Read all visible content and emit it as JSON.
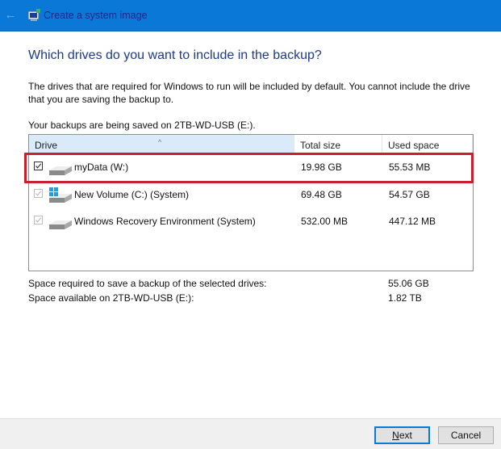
{
  "window": {
    "title": "Create a system image",
    "back_icon": "back-arrow-icon",
    "app_icon": "system-image-icon",
    "titlebar_color": "#0a78d7"
  },
  "page": {
    "heading": "Which drives do you want to include in the backup?",
    "description": "The drives that are required for Windows to run will be included by default. You cannot include the drive that you are saving the backup to.",
    "saved_on": "Your backups are being saved on 2TB-WD-USB (E:)."
  },
  "drive_list": {
    "columns": {
      "drive": "Drive",
      "total": "Total size",
      "used": "Used space"
    },
    "sort_indicator": "^",
    "rows": [
      {
        "name": "myData (W:)",
        "total": "19.98 GB",
        "used": "55.53 MB",
        "checked": true,
        "enabled": true,
        "icon": "drive-icon"
      },
      {
        "name": "New Volume (C:) (System)",
        "total": "69.48 GB",
        "used": "54.57 GB",
        "checked": true,
        "enabled": false,
        "icon": "windows-drive-icon"
      },
      {
        "name": "Windows Recovery Environment (System)",
        "total": "532.00 MB",
        "used": "447.12 MB",
        "checked": true,
        "enabled": false,
        "icon": "drive-icon"
      }
    ],
    "highlight_color": "#c8202e"
  },
  "summary": {
    "required_label": "Space required to save a backup of the selected drives:",
    "required_value": "55.06 GB",
    "available_label": "Space available on 2TB-WD-USB (E:):",
    "available_value": "1.82 TB"
  },
  "footer": {
    "next_mnemonic": "N",
    "next_rest": "ext",
    "cancel_label": "Cancel"
  }
}
